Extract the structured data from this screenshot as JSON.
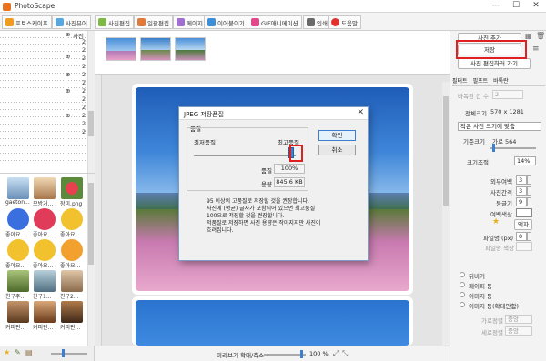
{
  "app": {
    "title": "PhotoScape"
  },
  "window_controls": {
    "minimize": "—",
    "maximize": "☐",
    "close": "✕"
  },
  "tabs": [
    {
      "label": "포토스케이프",
      "color": "#f29c1f"
    },
    {
      "label": "사진뷰어",
      "color": "#5aa7e0"
    },
    {
      "label": "사진편집",
      "color": "#7fb847"
    },
    {
      "label": "일괄편집",
      "color": "#e07a3a"
    },
    {
      "label": "페이지",
      "color": "#a070d0"
    },
    {
      "label": "이어붙이기",
      "color": "#3d8fd8"
    },
    {
      "label": "GIF애니메이션",
      "color": "#e04a8a"
    },
    {
      "label": "인쇄",
      "color": "#6a6a6a"
    },
    {
      "label": "도움말",
      "color": "#e03030"
    }
  ],
  "tree": {
    "expand_glyph": "⊕",
    "items": [
      "사진",
      "2",
      "2",
      "2",
      "2",
      "2",
      "2",
      "2",
      "2",
      "2",
      "2",
      "2",
      "2"
    ]
  },
  "thumbnails": [
    {
      "label": "gaeton...",
      "color": "#8fb3d9"
    },
    {
      "label": "모방거...",
      "color": "#d9a36b"
    },
    {
      "label": "장미.png",
      "color": "#d02b3a"
    },
    {
      "label": "좋아요...",
      "color": "#3b6fe0"
    },
    {
      "label": "좋아요...",
      "color": "#e03c5a"
    },
    {
      "label": "좋아요...",
      "color": "#f2c12e"
    },
    {
      "label": "좋아요...",
      "color": "#f2c12e"
    },
    {
      "label": "좋아요...",
      "color": "#f2c12e"
    },
    {
      "label": "좋아요...",
      "color": "#f2c12e"
    },
    {
      "label": "친구주...",
      "color": "#7a9a4a"
    },
    {
      "label": "친구1...",
      "color": "#6b8fa0"
    },
    {
      "label": "친구2...",
      "color": "#b08a6a"
    },
    {
      "label": "커피판...",
      "color": "#8a5a3a"
    },
    {
      "label": "커피판...",
      "color": "#a0603a"
    },
    {
      "label": "커피판...",
      "color": "#70482a"
    }
  ],
  "right_panel": {
    "add_photo": "사진 추가",
    "save": "저장",
    "go_edit": "사진 편집하러 가기",
    "panel_tabs": [
      "필터트",
      "필프트",
      "바톡란"
    ],
    "margin_label": "바독판 칸 수",
    "margin_value": "2",
    "full_size_label": "전체크기",
    "full_size_value": "570 x 1281",
    "fit_mode": "작은 사진 크기에 맞춤",
    "base_size_label": "기준크기",
    "base_size_value": "가로 564",
    "size_adjust_label": "크기조절",
    "size_adjust_value": "14%",
    "outer_margin_label": "외부여백",
    "outer_margin_value": "3",
    "photo_gap_label": "사진간격",
    "photo_gap_value": "3",
    "round_label": "둥글기",
    "round_value": "9",
    "margin_color_label": "여백색상",
    "frame_button": "액자",
    "frame_line_label": "파일명 (px)",
    "frame_line_value": "0",
    "frame_color_label": "파일명 색상",
    "opt_flip": "뒤비기",
    "opt_margin": "페이퍼 등",
    "opt_image": "이미지 등",
    "opt_image2": "이미지 등(확대안함)",
    "align_h_label": "가로정렬",
    "align_h_value": "중앙",
    "align_v_label": "세로정렬",
    "align_v_value": "중앙"
  },
  "status_bar": {
    "zoom_label": "미리보기 확대/축소",
    "zoom_value": "100 %"
  },
  "dialog": {
    "title": "JPEG 저장품질",
    "close_glyph": "✕",
    "group_label": "품질",
    "min_quality": "최저품질",
    "max_quality": "최고품질",
    "quality_label": "품질",
    "quality_value": "100%",
    "size_label": "용량",
    "size_value": "845.6 KB",
    "ok": "확인",
    "cancel": "취소",
    "quality_level": 1.0,
    "info_lines": [
      "95 이상의 고품질로 저장할 것을 권장합니다.",
      "사진에 (평균) 글자가 포함되어 있으면 최고품질",
      "100으로 저장할 것을 권장합니다.",
      "저품질로 저장하면 사진 용량은 작아지지만 사진이",
      "흐려집니다."
    ]
  }
}
